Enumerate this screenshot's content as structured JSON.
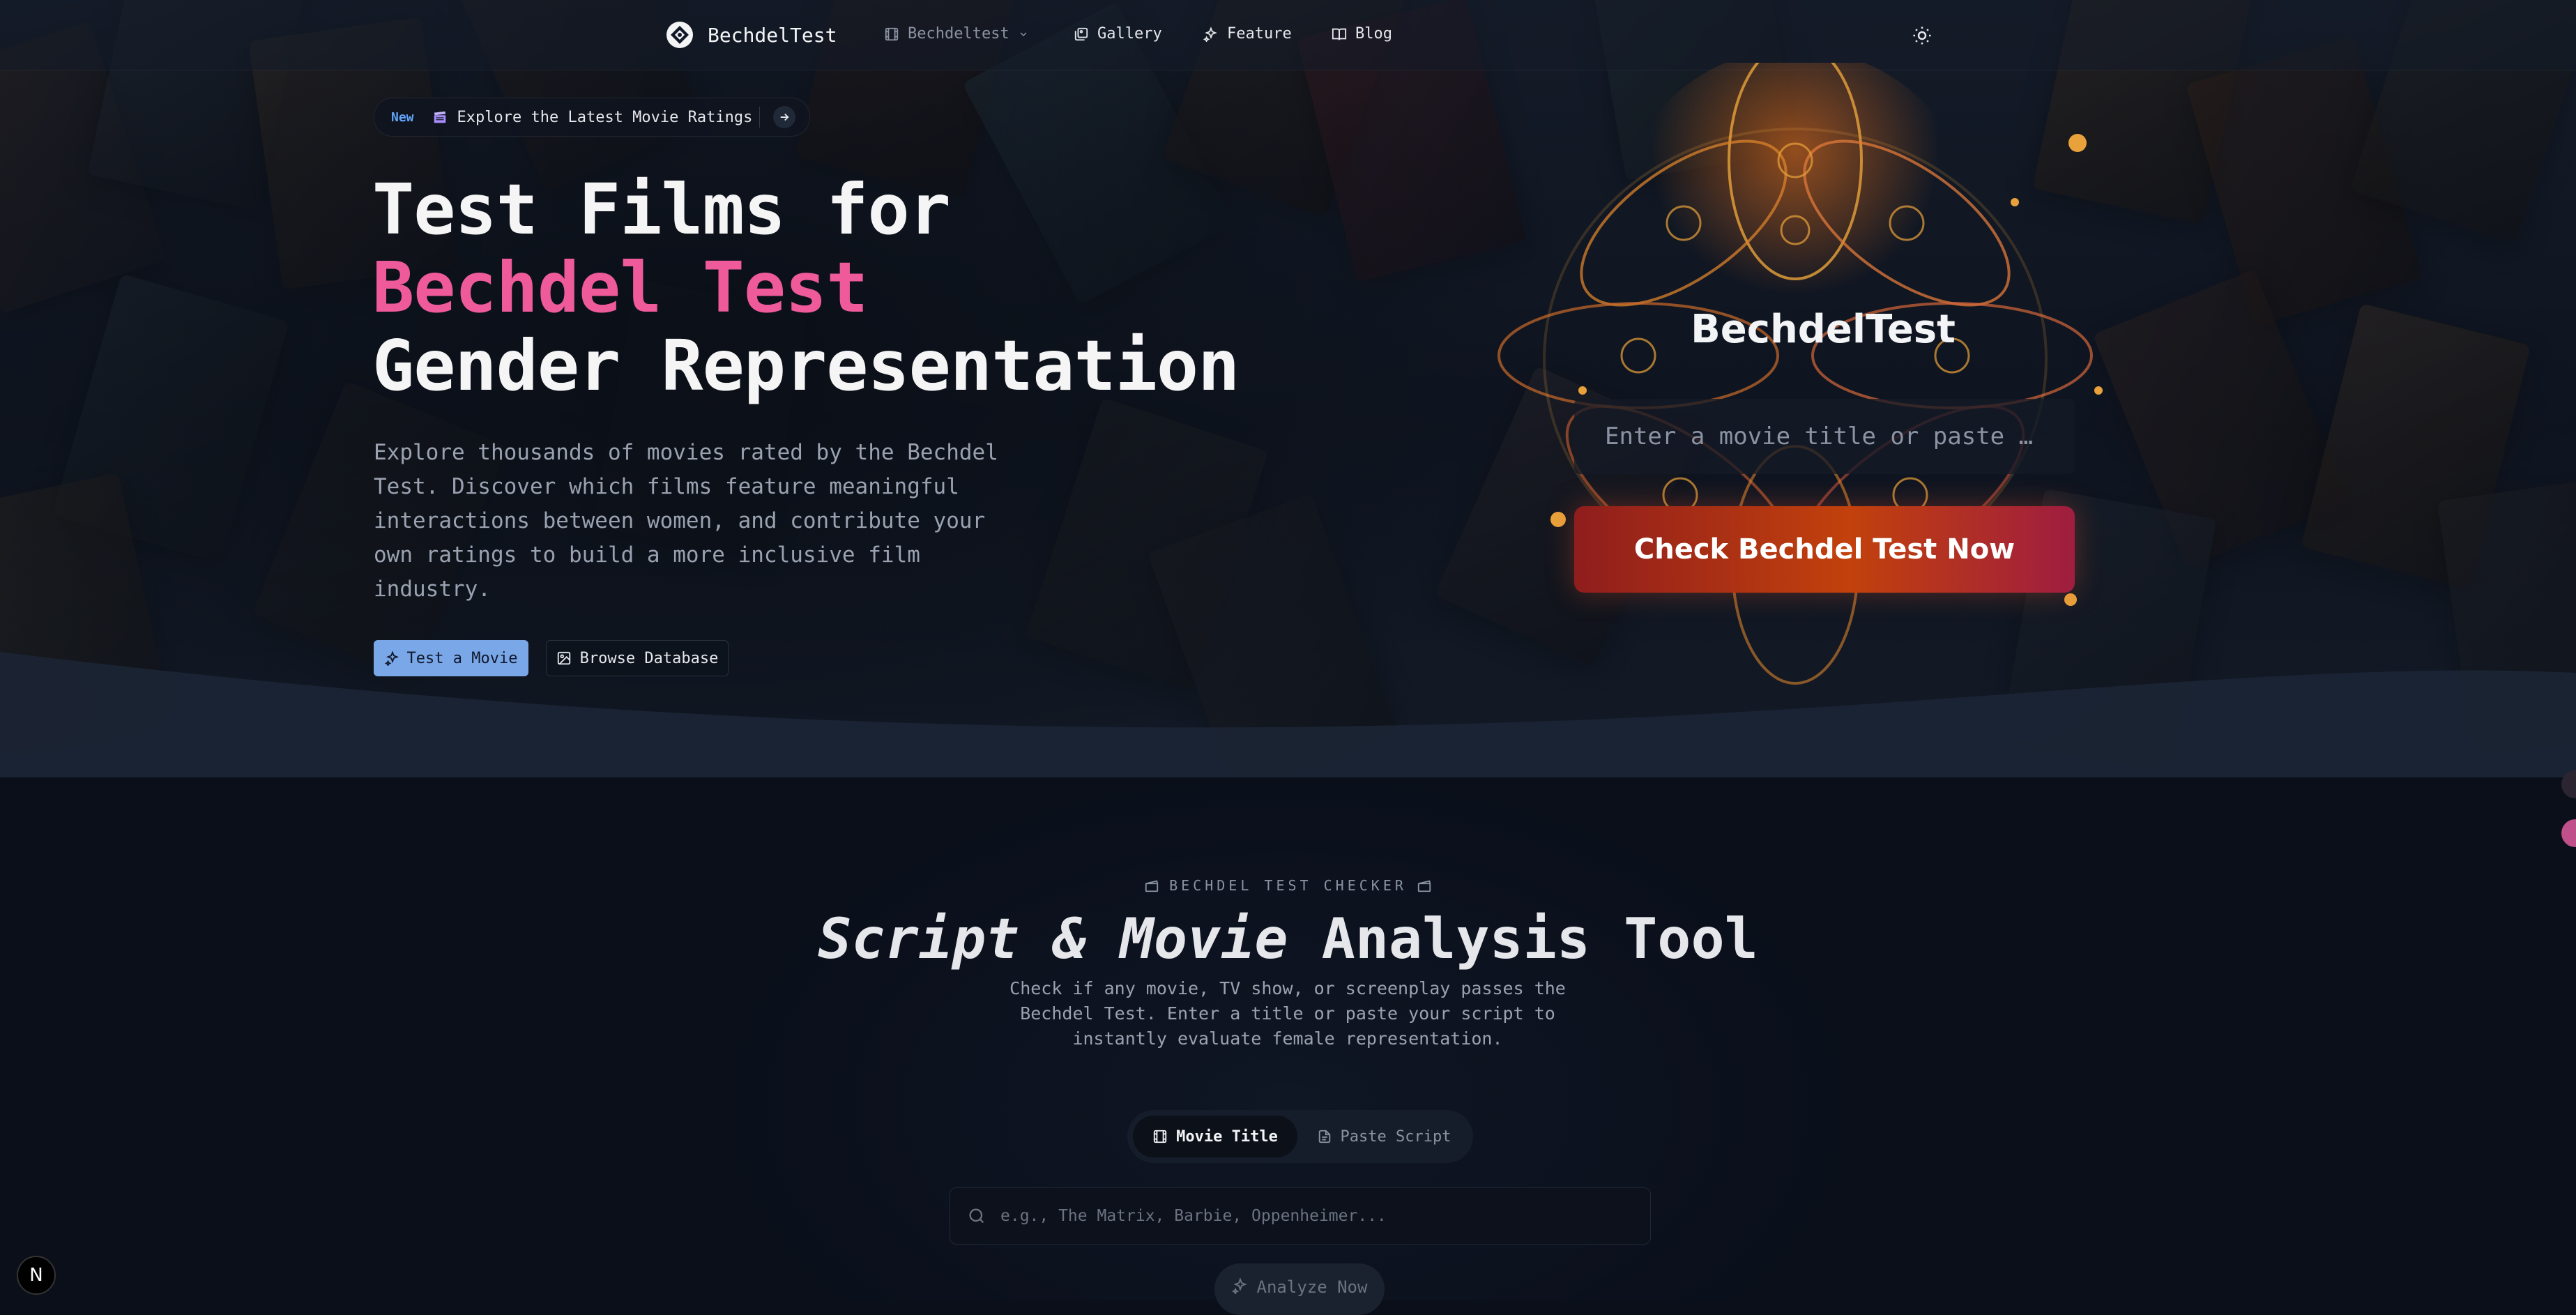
{
  "colors": {
    "accent_pink": "#ee5a9a",
    "accent_blue": "#7aa7e8",
    "badge_blue": "#60a5fa",
    "button_gradient": [
      "#8f1d1d",
      "#c2410c",
      "#9f1d3f"
    ]
  },
  "nav": {
    "brand": "BechdelTest",
    "items": [
      {
        "label": "Bechdeltest",
        "icon": "film-icon",
        "has_dropdown": true
      },
      {
        "label": "Gallery",
        "icon": "gallery-icon"
      },
      {
        "label": "Feature",
        "icon": "sparkles-icon"
      },
      {
        "label": "Blog",
        "icon": "book-icon"
      }
    ],
    "theme_icon": "sun-icon"
  },
  "announcement": {
    "badge": "New",
    "text": "Explore the Latest Movie Ratings",
    "icon": "clapperboard-icon"
  },
  "hero": {
    "line1": "Test Films for",
    "line2": "Bechdel Test",
    "line3": "Gender Representation",
    "description": "Explore thousands of movies rated by the Bechdel Test. Discover which films feature meaningful interactions between women, and contribute your own ratings to build a more inclusive film industry.",
    "primary_button": "Test a Movie",
    "secondary_button": "Browse Database"
  },
  "widget": {
    "title": "BechdelTest",
    "input_placeholder": "Enter a movie title or paste you…",
    "button": "Check Bechdel Test Now"
  },
  "checker": {
    "eyebrow": "BECHDEL TEST CHECKER",
    "title_italic": "Script & Movie",
    "title_rest": "Analysis Tool",
    "description": "Check if any movie, TV show, or screenplay passes the Bechdel Test. Enter a title or paste your script to instantly evaluate female representation.",
    "tabs": [
      {
        "label": "Movie Title",
        "icon": "film-icon",
        "active": true
      },
      {
        "label": "Paste Script",
        "icon": "document-icon",
        "active": false
      }
    ],
    "search_placeholder": "e.g., The Matrix, Barbie, Oppenheimer...",
    "analyze_button": "Analyze Now"
  },
  "corner_badge": "N"
}
